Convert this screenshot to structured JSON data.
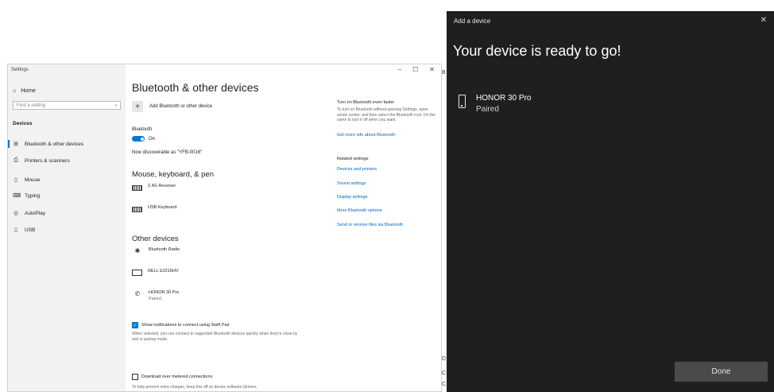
{
  "settings": {
    "window_title": "Settings",
    "controls": {
      "minimize": "–",
      "maximize": "☐",
      "close": "✕"
    },
    "sidebar": {
      "home": {
        "icon": "home-icon",
        "glyph": "⌂",
        "label": "Home"
      },
      "search_placeholder": "Find a setting",
      "search_icon": "⌕",
      "section": "Devices",
      "items": [
        {
          "id": "bluetooth",
          "icon": "bluetooth-devices-icon",
          "glyph": "⊞",
          "label": "Bluetooth & other devices",
          "active": true
        },
        {
          "id": "printers",
          "icon": "printer-icon",
          "glyph": "⎙",
          "label": "Printers & scanners",
          "active": false
        },
        {
          "id": "mouse",
          "icon": "mouse-icon",
          "glyph": "▯",
          "label": "Mouse",
          "active": false
        },
        {
          "id": "typing",
          "icon": "keyboard-icon",
          "glyph": "⌨",
          "label": "Typing",
          "active": false
        },
        {
          "id": "autoplay",
          "icon": "autoplay-icon",
          "glyph": "◎",
          "label": "AutoPlay",
          "active": false
        },
        {
          "id": "usb",
          "icon": "usb-icon",
          "glyph": "▯",
          "label": "USB",
          "active": false
        }
      ]
    },
    "main": {
      "title": "Bluetooth & other devices",
      "add_device": "Add Bluetooth or other device",
      "bluetooth_label": "Bluetooth",
      "toggle_state": "On",
      "discoverable": "Now discoverable as \"YFB-0016\"",
      "mouse_section": "Mouse, keyboard, & pen",
      "input_devices": [
        {
          "name": "2.4G Receiver",
          "icon": "keyboard-icon"
        },
        {
          "name": "USB Keyboard",
          "icon": "keyboard-icon"
        }
      ],
      "other_section": "Other devices",
      "other_devices": [
        {
          "name": "Bluetooth Radio",
          "status": "",
          "icon": "bluetooth-icon",
          "glyph": "✱"
        },
        {
          "name": "DELL E2216HV",
          "status": "",
          "icon": "monitor-icon",
          "glyph": ""
        },
        {
          "name": "HONOR 30 Pro",
          "status": "Paired",
          "icon": "phone-icon",
          "glyph": "✆"
        }
      ],
      "swift_pair": {
        "label": "Show notifications to connect using Swift Pair",
        "checked": true,
        "desc": "When selected, you can connect to supported Bluetooth devices quickly when they're close by and in pairing mode."
      },
      "metered": {
        "label": "Download over metered connections",
        "checked": false,
        "desc": "To help prevent extra charges, keep this off so device software (drivers,"
      }
    },
    "right": {
      "tip_heading": "Turn on Bluetooth even faster",
      "tip_text": "To turn on Bluetooth without opening Settings, open action center, and then select the Bluetooth icon. Do the same to turn it off when you want.",
      "tip_link": "Get more info about Bluetooth",
      "related_heading": "Related settings",
      "related_links": [
        "Devices and printers",
        "Sound settings",
        "Display settings",
        "More Bluetooth options",
        "Send or receive files via Bluetooth"
      ]
    }
  },
  "dialog": {
    "title": "Add a device",
    "close": "✕",
    "heading": "Your device is ready to go!",
    "device": {
      "name": "HONOR 30 Pro",
      "status": "Paired",
      "icon": "phone-icon"
    },
    "done_label": "Done"
  },
  "edge_fragments": [
    "B",
    "D",
    "C",
    "C"
  ],
  "colors": {
    "accent": "#0078d7",
    "link": "#0067c0",
    "dialog_bg": "#1f1f1f",
    "done_bg": "#4a4a4a"
  }
}
